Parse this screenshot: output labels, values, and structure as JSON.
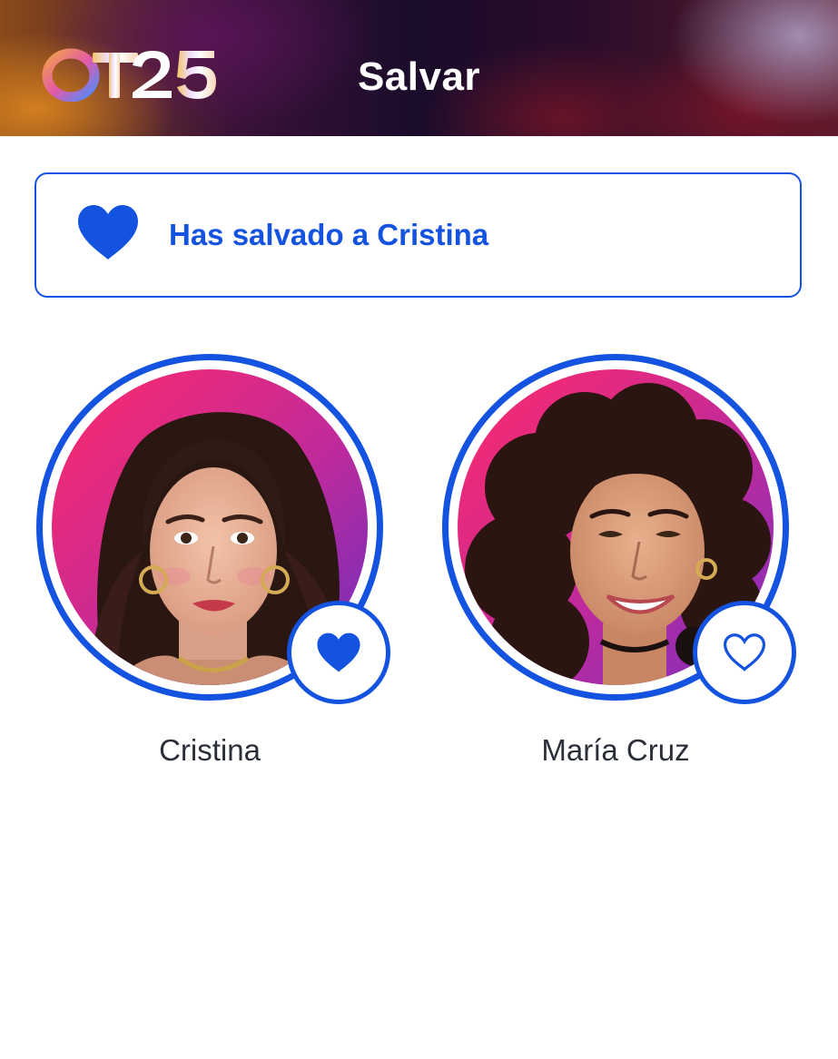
{
  "header": {
    "logo_text": "OT25",
    "title": "Salvar"
  },
  "banner": {
    "icon": "heart-filled-icon",
    "message": "Has salvado a Cristina"
  },
  "contestants": [
    {
      "name": "Cristina",
      "vote_icon": "heart-filled-icon",
      "selected": true
    },
    {
      "name": "María Cruz",
      "vote_icon": "heart-outline-icon",
      "selected": false
    }
  ],
  "colors": {
    "accent": "#1453e0",
    "text": "#2b2f3a",
    "photo_background_left": "#e8256e",
    "photo_background_right": "#7a2fc0"
  }
}
